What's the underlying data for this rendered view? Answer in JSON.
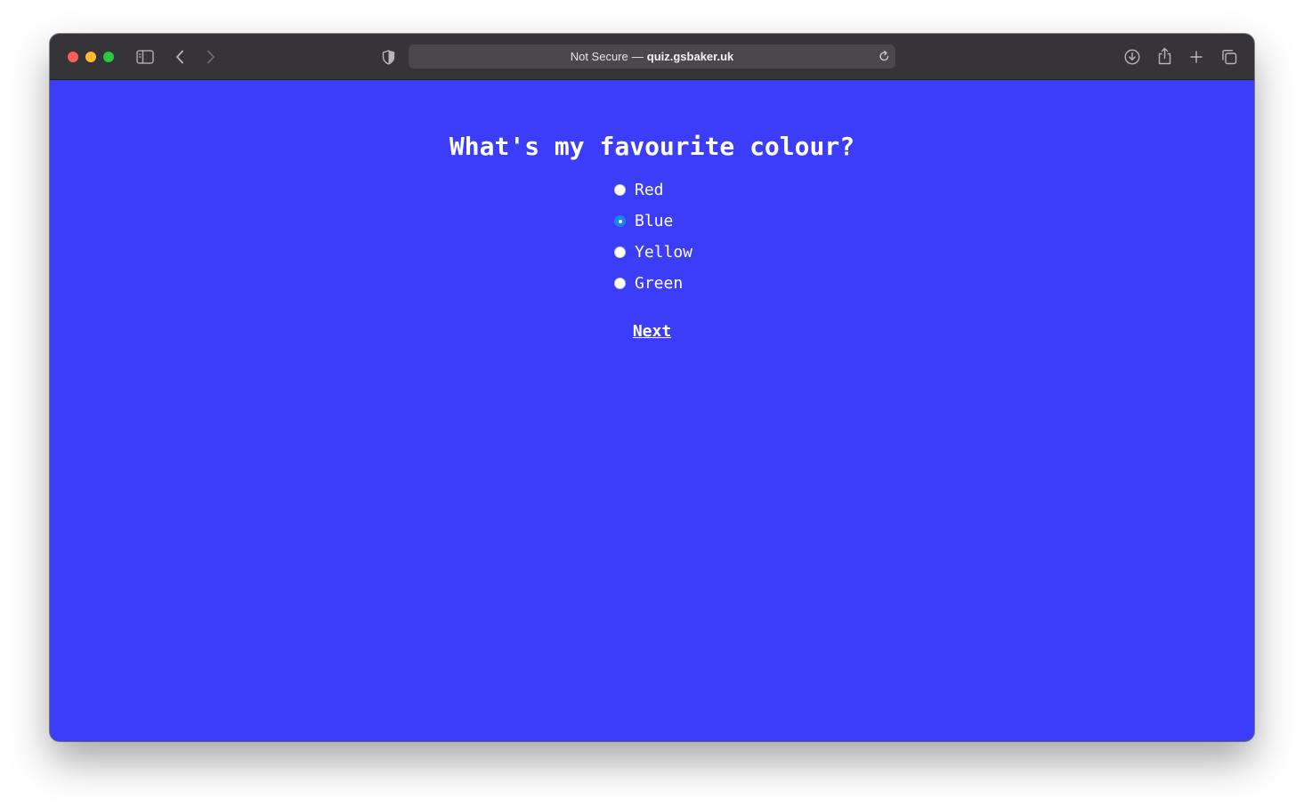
{
  "browser": {
    "address_prefix": "Not Secure",
    "address_separator": "—",
    "address_host": "quiz.gsbaker.uk",
    "chrome_color": "#363438",
    "address_bar_color": "#4a484d"
  },
  "page": {
    "background_color": "#3c3df9",
    "question": "What's my favourite colour?",
    "options": [
      {
        "label": "Red",
        "selected": false
      },
      {
        "label": "Blue",
        "selected": true
      },
      {
        "label": "Yellow",
        "selected": false
      },
      {
        "label": "Green",
        "selected": false
      }
    ],
    "next_label": "Next"
  },
  "icons": [
    "sidebar-icon",
    "back-icon",
    "forward-icon",
    "shield-icon",
    "reload-icon",
    "download-icon",
    "share-icon",
    "new-tab-icon",
    "tab-overview-icon"
  ]
}
